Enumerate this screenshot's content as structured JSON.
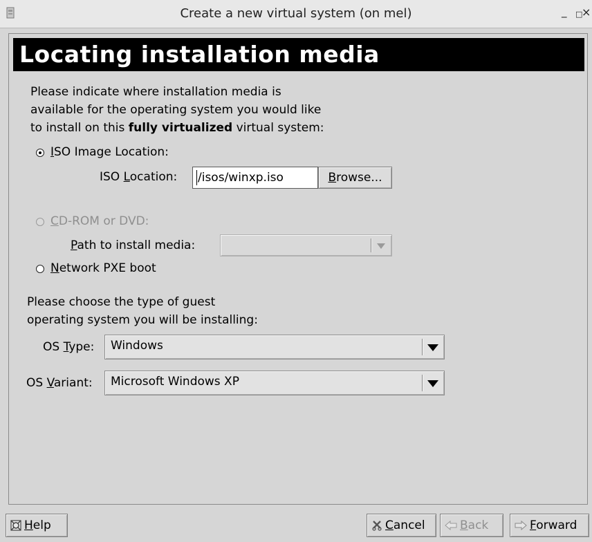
{
  "window": {
    "title": "Create a new virtual system (on mel)",
    "minimize_glyph": "_",
    "maximize_glyph": "□",
    "close_glyph": "×"
  },
  "header": {
    "title": "Locating installation media"
  },
  "intro": {
    "line1": "Please indicate where installation media is",
    "line2": "available for the operating system you would like",
    "line3_prefix": "to install on this ",
    "line3_bold": "fully virtualized",
    "line3_suffix": " virtual system:"
  },
  "iso": {
    "radio_mnemonic": "I",
    "radio_label_rest": "SO Image Location:",
    "location_label_pre": "ISO ",
    "location_label_mnemonic": "L",
    "location_label_post": "ocation:",
    "location_value": "/isos/winxp.iso",
    "browse_mnemonic": "B",
    "browse_rest": "rowse...",
    "selected": true
  },
  "cdrom": {
    "radio_mnemonic": "C",
    "radio_label_rest": "D-ROM or DVD:",
    "path_mnemonic": "P",
    "path_label_rest": "ath to install media:",
    "path_value": "",
    "enabled": false
  },
  "pxe": {
    "radio_mnemonic": "N",
    "radio_label_rest": "etwork PXE boot"
  },
  "guest": {
    "line1": "Please choose the type of guest",
    "line2": "operating system you will be installing:"
  },
  "os_type": {
    "label_pre": "OS ",
    "label_mnemonic": "T",
    "label_post": "ype:",
    "value": "Windows"
  },
  "os_variant": {
    "label_pre": "OS ",
    "label_mnemonic": "V",
    "label_post": "ariant:",
    "value": "Microsoft Windows XP"
  },
  "footer": {
    "help_mnemonic": "H",
    "help_rest": "elp",
    "cancel_mnemonic": "C",
    "cancel_rest": "ancel",
    "back_mnemonic": "B",
    "back_rest": "ack",
    "forward_mnemonic": "F",
    "forward_rest": "orward"
  },
  "icons": {
    "app": "app-icon",
    "help": "help-icon",
    "cancel": "cancel-icon",
    "back": "back-arrow-icon",
    "forward": "forward-arrow-icon"
  }
}
